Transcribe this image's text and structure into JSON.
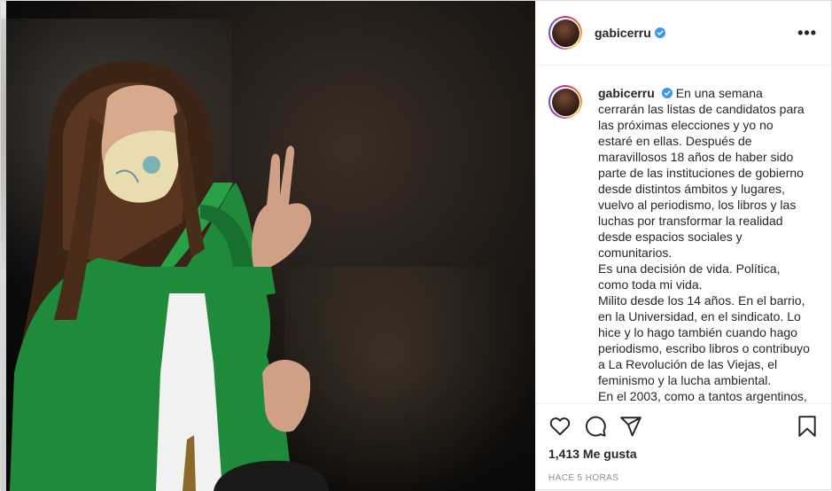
{
  "header": {
    "username": "gabicerru"
  },
  "caption": {
    "username": "gabicerru",
    "paragraphs": [
      "En una semana cerrarán las listas de candidatos para las próximas elecciones y yo no estaré en ellas. Después de maravillosos 18 años de haber sido parte de las instituciones de gobierno desde distintos ámbitos y lugares, vuelvo al periodismo, los libros y las luchas por transformar la realidad desde espacios sociales y comunitarios.",
      "Es una decisión de vida. Política, como toda mi vida.",
      "Milito desde los 14 años. En el barrio, en la Universidad, en el sindicato. Lo hice y lo hago también cuando hago periodismo, escribo libros o contribuyo a La Revolución de las Viejas, el feminismo y la lucha ambiental.",
      "En el 2003, como a tantos argentinos,"
    ]
  },
  "actions": {
    "icons": [
      "heart-icon",
      "comment-icon",
      "share-icon",
      "bookmark-icon"
    ]
  },
  "likes": "1,413 Me gusta",
  "timestamp": "HACE 5 HORAS",
  "colors": {
    "verified": "#3897f0",
    "text": "#262626",
    "muted": "#8e8e8e",
    "divider": "#efefef"
  }
}
